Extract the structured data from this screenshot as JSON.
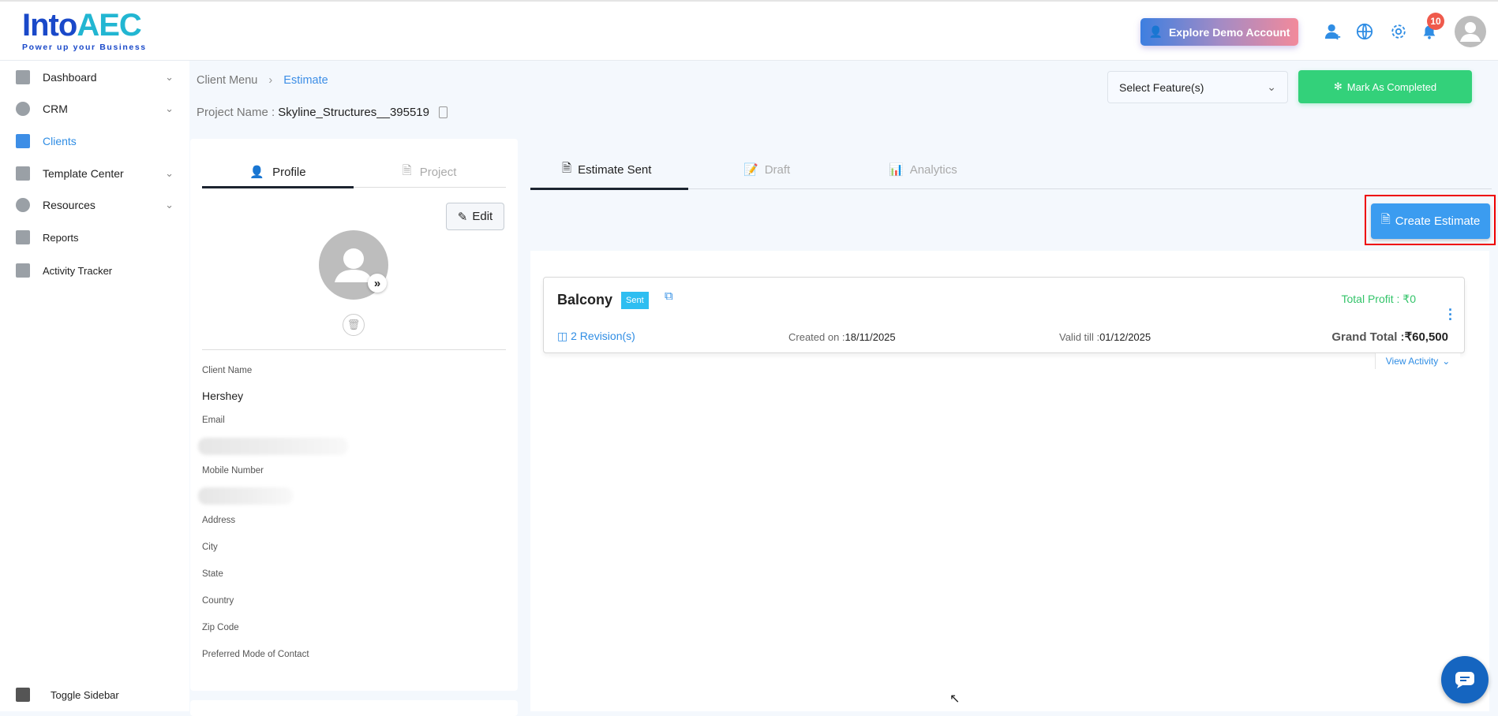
{
  "header": {
    "logo_main": "Into",
    "logo_accent": "AEC",
    "logo_tagline": "Power up your Business",
    "demo_button": "Explore Demo Account",
    "notification_count": "10"
  },
  "sidebar": {
    "items": [
      {
        "label": "Dashboard"
      },
      {
        "label": "CRM"
      },
      {
        "label": "Clients"
      },
      {
        "label": "Template Center"
      },
      {
        "label": "Resources"
      },
      {
        "label": "Reports"
      },
      {
        "label": "Activity Tracker"
      }
    ],
    "toggle": "Toggle Sidebar"
  },
  "breadcrumb": {
    "parent": "Client Menu",
    "current": "Estimate"
  },
  "project": {
    "label": "Project Name :",
    "value": "Skyline_Structures__395519"
  },
  "toolbar": {
    "select_placeholder": "Select Feature(s)",
    "mark_completed": "Mark As Completed"
  },
  "profile": {
    "tabs": [
      "Profile",
      "Project"
    ],
    "edit": "Edit",
    "fields": {
      "client_name_label": "Client Name",
      "client_name": "Hershey",
      "email_label": "Email",
      "mobile_label": "Mobile Number",
      "address_label": "Address",
      "city_label": "City",
      "state_label": "State",
      "country_label": "Country",
      "zip_label": "Zip Code",
      "contact_mode_label": "Preferred Mode of Contact"
    }
  },
  "estimates": {
    "tabs": [
      "Estimate Sent",
      "Draft",
      "Analytics"
    ],
    "create_button": "Create Estimate",
    "items": [
      {
        "name": "Balcony",
        "status": "Sent",
        "total_profit": "Total Profit : ₹0",
        "revisions": "2 Revision(s)",
        "created_label": "Created on :",
        "created": "18/11/2025",
        "valid_label": "Valid till :",
        "valid": "01/12/2025",
        "grand_total_label": "Grand Total :",
        "grand_total": "₹60,500",
        "view_activity": "View Activity"
      }
    ]
  },
  "colors": {
    "accent": "#2f8de4",
    "green": "#33d17a",
    "badge": "#ef5a4c",
    "sent_badge": "#2ebef1"
  }
}
